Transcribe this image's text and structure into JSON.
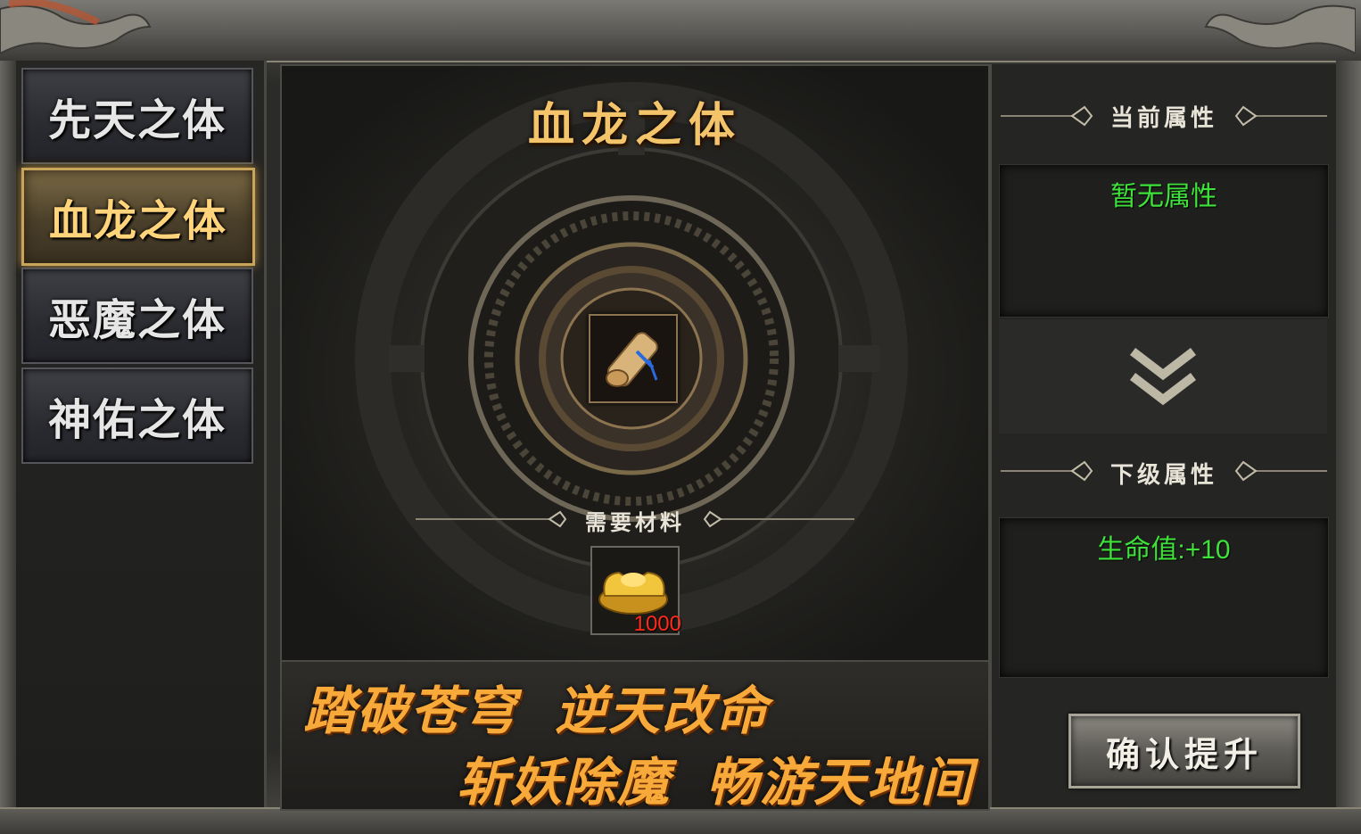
{
  "sidebar": {
    "tabs": [
      {
        "label": "先天之体",
        "active": false
      },
      {
        "label": "血龙之体",
        "active": true
      },
      {
        "label": "恶魔之体",
        "active": false
      },
      {
        "label": "神佑之体",
        "active": false
      }
    ]
  },
  "center": {
    "title": "血龙之体",
    "item_icon": "scroll-icon",
    "material_label": "需要材料",
    "material": {
      "icon": "gold-ingot-icon",
      "count": "1000"
    }
  },
  "banner": {
    "line1a": "踏破苍穹",
    "line1b": "逆天改命",
    "line2a": "斩妖除魔",
    "line2b": "畅游天地间"
  },
  "right": {
    "current_label": "当前属性",
    "current_value": "暂无属性",
    "next_label": "下级属性",
    "next_value": "生命值:+10",
    "arrow_icon": "double-chevron-down-icon",
    "confirm_label": "确认提升"
  },
  "colors": {
    "accent_gold": "#f3c46a",
    "attr_green": "#3ee23a",
    "count_red": "#ff2a1a"
  }
}
